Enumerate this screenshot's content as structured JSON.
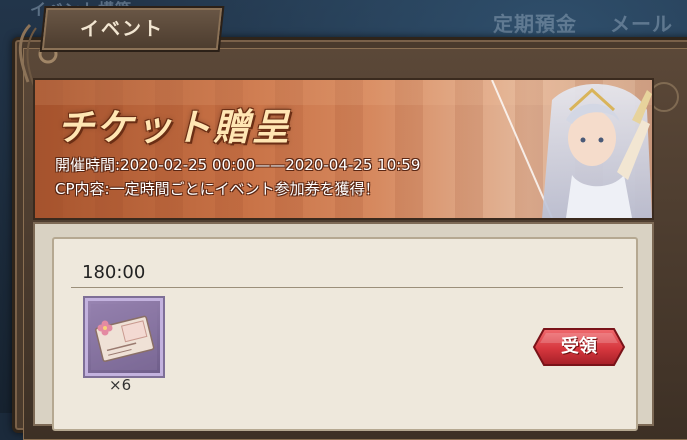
{
  "background": {
    "left_text": "イベント構築",
    "menu_1": "定期預金",
    "menu_2": "メール"
  },
  "tab": {
    "label": "イベント"
  },
  "banner": {
    "title": "チケット贈呈",
    "period": "開催時間:2020-02-25 00:00——2020-04-25 10:59",
    "content": "CP内容:一定時間ごとにイベント参加券を獲得！"
  },
  "reward": {
    "timer": "180:00",
    "quantity": "×6",
    "item_icon": "ticket-icon",
    "claim_label": "受領"
  },
  "colors": {
    "banner_accent": "#c97347",
    "title_text": "#ffe6b3",
    "button_red": "#d6373e",
    "item_frame": "#8a75a8"
  }
}
